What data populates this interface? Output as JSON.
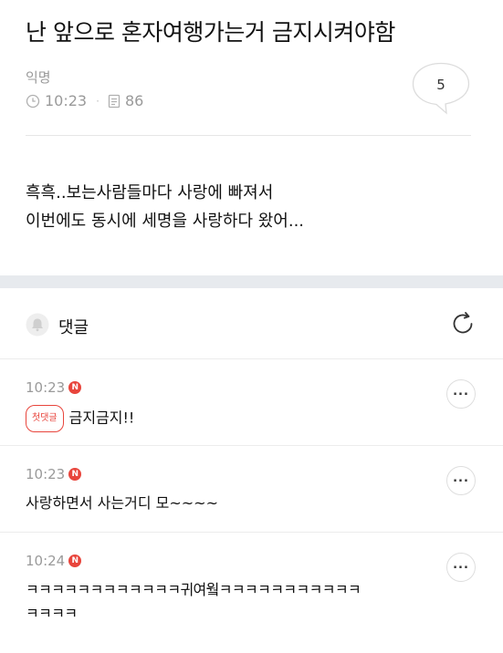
{
  "post": {
    "title": "난 앞으로 혼자여행가는거 금지시켜야함",
    "author": "익명",
    "time": "10:23",
    "views": "86",
    "comment_count": "5",
    "body_lines": [
      "흑흑..보는사람들마다 사랑에 빠져서",
      "이번에도 동시에 세명을 사랑하다 왔어..."
    ]
  },
  "comments_section": {
    "title": "댓글"
  },
  "comments": [
    {
      "time": "10:23",
      "badge": "N",
      "first_label": "첫댓글",
      "lines": [
        "금지금지!!"
      ]
    },
    {
      "time": "10:23",
      "badge": "N",
      "lines": [
        "사랑하면서 사는거디 모~~~~"
      ]
    },
    {
      "time": "10:24",
      "badge": "N",
      "lines": [
        "ㅋㅋㅋㅋㅋㅋㅋㅋㅋㅋㅋㅋ귀여웤ㅋㅋㅋㅋㅋㅋㅋㅋㅋㅋㅋ",
        "ㅋㅋㅋㅋ"
      ]
    }
  ],
  "colors": {
    "accent": "#e8453c",
    "muted": "#9a9a9a",
    "section_gap": "#e7eaee"
  },
  "icons": {
    "clock": "clock-icon",
    "views": "document-icon",
    "comment": "speech-bubble-icon",
    "bell": "bell-icon",
    "refresh": "refresh-icon",
    "more": "more-dots-icon"
  }
}
